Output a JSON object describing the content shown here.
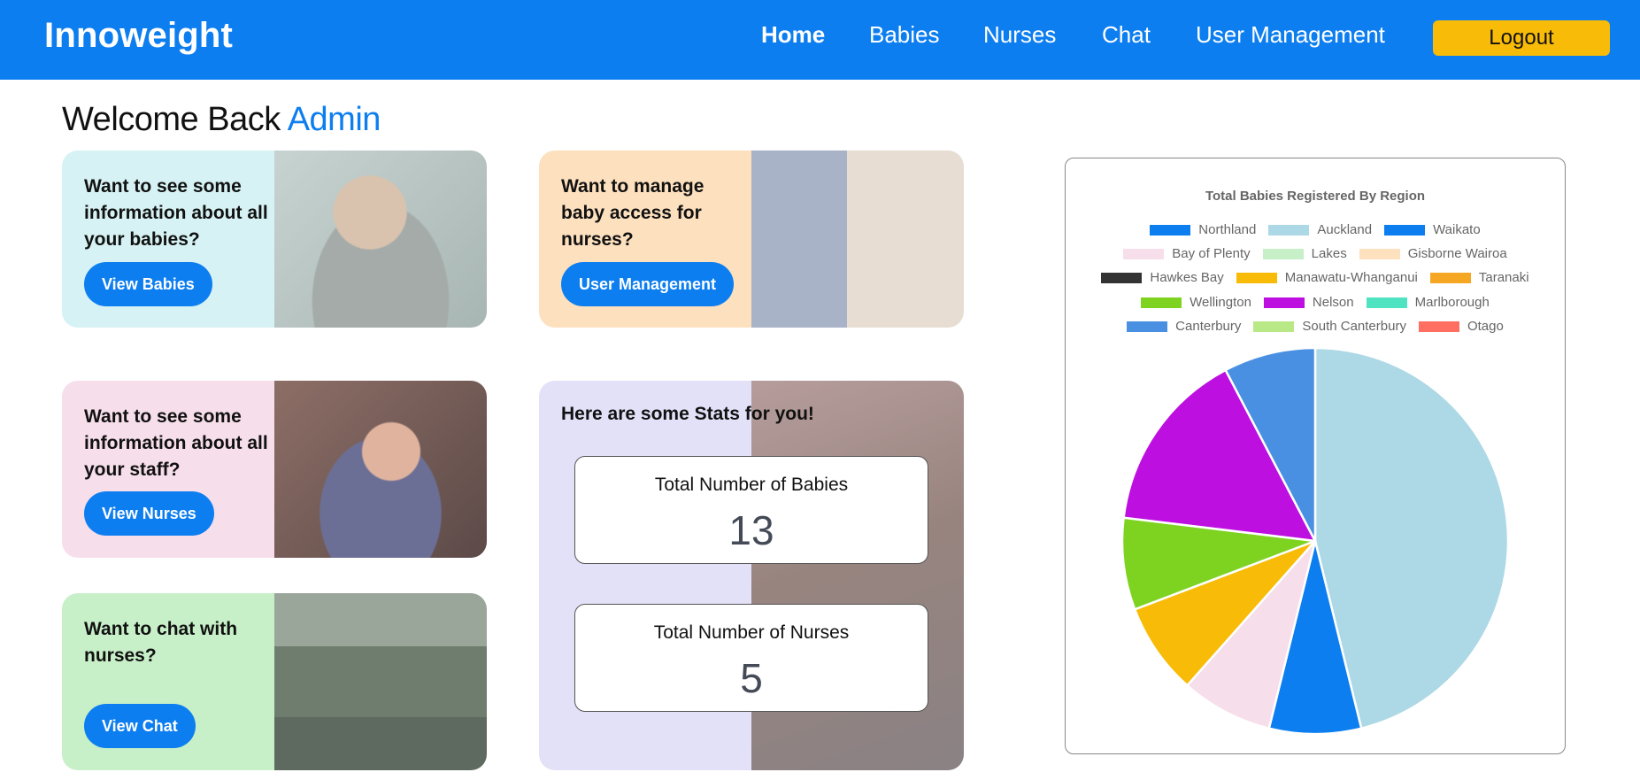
{
  "navbar": {
    "brand": "Innoweight",
    "links": [
      "Home",
      "Babies",
      "Nurses",
      "Chat",
      "User Management"
    ],
    "logout_label": "Logout",
    "color": "#0d7ef0"
  },
  "welcome": {
    "prefix": "Welcome Back",
    "name": "Admin"
  },
  "cards": {
    "babies": {
      "title": "Want to see some information about all your babies?",
      "button": "View Babies",
      "bg": "#d6f2f4"
    },
    "access": {
      "title": "Want to manage baby access for nurses?",
      "button": "User Management",
      "bg": "#fde0be"
    },
    "staff": {
      "title": "Want to see some information about all your staff?",
      "button": "View Nurses",
      "bg": "#f6deeb"
    },
    "chat": {
      "title": "Want to chat with nurses?",
      "button": "View Chat",
      "bg": "#c8f0c8"
    }
  },
  "stats": {
    "title": "Here are some Stats for you!",
    "babies_label": "Total Number of Babies",
    "babies_value": "13",
    "nurses_label": "Total Number of Nurses",
    "nurses_value": "5"
  },
  "chart_data": {
    "type": "pie",
    "title": "Total Babies Registered By Region",
    "legend_position": "top",
    "categories": [
      "Northland",
      "Auckland",
      "Waikato",
      "Bay of Plenty",
      "Lakes",
      "Gisborne Wairoa",
      "Hawkes Bay",
      "Manawatu-Whanganui",
      "Taranaki",
      "Wellington",
      "Nelson",
      "Marlborough",
      "Canterbury",
      "South Canterbury",
      "Otago"
    ],
    "values": [
      0,
      6,
      1,
      1,
      0,
      0,
      0,
      1,
      0,
      1,
      2,
      0,
      1,
      0,
      0
    ],
    "colors": [
      "#0d7ef0",
      "#add8e6",
      "#0d7ef0",
      "#f6deeb",
      "#c8f0c8",
      "#fde0be",
      "#333333",
      "#f8bb08",
      "#f5a623",
      "#7ed321",
      "#bd10e0",
      "#50e3c2",
      "#4a90e2",
      "#b8e986",
      "#ff6f61"
    ]
  }
}
